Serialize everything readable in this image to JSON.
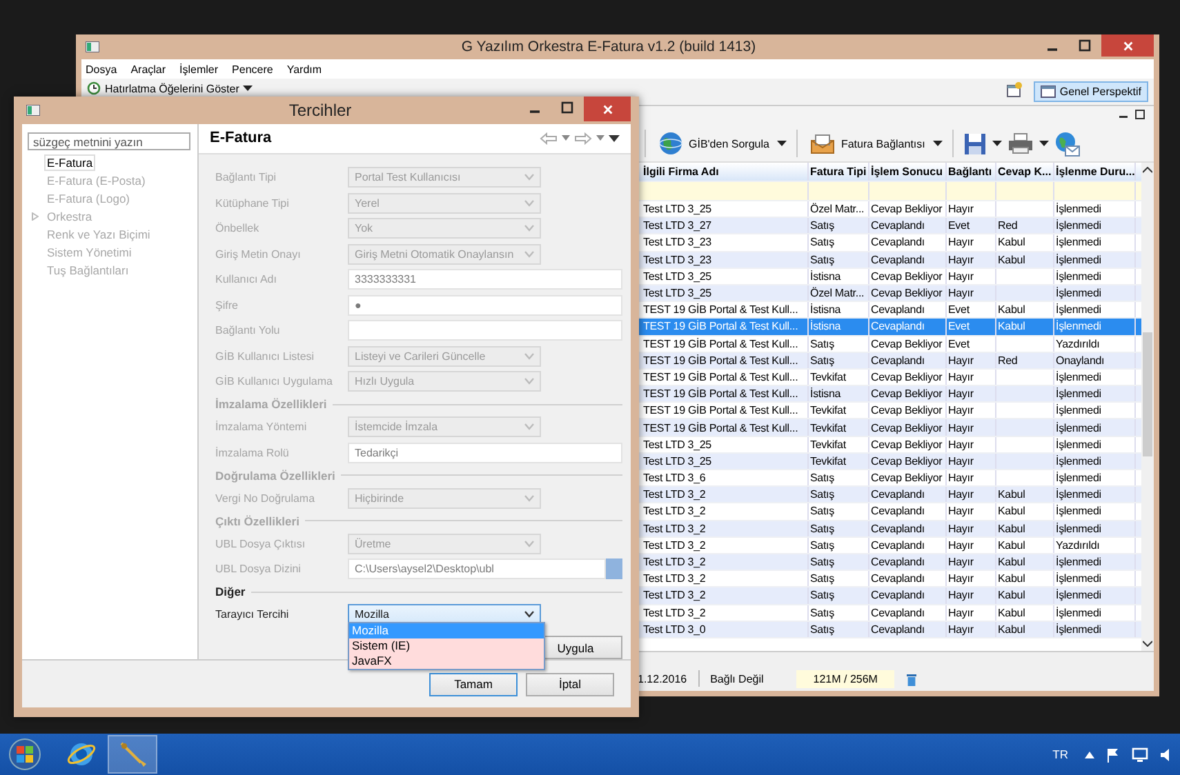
{
  "main_window": {
    "title": "G Yazılım Orkestra E-Fatura v1.2 (build 1413)",
    "menu": [
      "Dosya",
      "Araçlar",
      "İşlemler",
      "Pencere",
      "Yardım"
    ],
    "reminder_button": "Hatırlatma Öğelerini Göster",
    "perspective_button": {
      "label": "Genel Perspektif",
      "selected": true
    },
    "query_button": "GİB'den Sorgula",
    "link_button": "Fatura Bağlantısı",
    "table": {
      "columns": [
        "İlgili Firma Adı",
        "Fatura Tipi",
        "İşlem Sonucu",
        "Bağlantı",
        "Cevap K...",
        "İşlenme Duru..."
      ],
      "rows": [
        {
          "cells": [
            "Test LTD 3_25",
            "Özel Matr...",
            "Cevap Bekliyor",
            "Hayır",
            "",
            "İşlenmedi"
          ],
          "selected": false
        },
        {
          "cells": [
            "Test LTD 3_27",
            "Satış",
            "Cevaplandı",
            "Evet",
            "Red",
            "İşlenmedi"
          ],
          "selected": false
        },
        {
          "cells": [
            "Test LTD 3_23",
            "Satış",
            "Cevaplandı",
            "Hayır",
            "Kabul",
            "İşlenmedi"
          ],
          "selected": false
        },
        {
          "cells": [
            "Test LTD 3_23",
            "Satış",
            "Cevaplandı",
            "Hayır",
            "Kabul",
            "İşlenmedi"
          ],
          "selected": false
        },
        {
          "cells": [
            "Test LTD 3_25",
            "İstisna",
            "Cevap Bekliyor",
            "Hayır",
            "",
            "İşlenmedi"
          ],
          "selected": false
        },
        {
          "cells": [
            "Test LTD 3_25",
            "Özel Matr...",
            "Cevap Bekliyor",
            "Hayır",
            "",
            "İşlenmedi"
          ],
          "selected": false
        },
        {
          "cells": [
            "TEST 19 GİB Portal & Test Kull...",
            "İstisna",
            "Cevaplandı",
            "Evet",
            "Kabul",
            "İşlenmedi"
          ],
          "selected": false
        },
        {
          "cells": [
            "TEST 19 GİB Portal & Test Kull...",
            "İstisna",
            "Cevaplandı",
            "Evet",
            "Kabul",
            "İşlenmedi"
          ],
          "selected": true
        },
        {
          "cells": [
            "TEST 19 GİB Portal & Test Kull...",
            "Satış",
            "Cevap Bekliyor",
            "Evet",
            "",
            "Yazdırıldı"
          ],
          "selected": false
        },
        {
          "cells": [
            "TEST 19 GİB Portal & Test Kull...",
            "Satış",
            "Cevaplandı",
            "Hayır",
            "Red",
            "Onaylandı"
          ],
          "selected": false
        },
        {
          "cells": [
            "TEST 19 GİB Portal & Test Kull...",
            "Tevkifat",
            "Cevap Bekliyor",
            "Hayır",
            "",
            "İşlenmedi"
          ],
          "selected": false
        },
        {
          "cells": [
            "TEST 19 GİB Portal & Test Kull...",
            "İstisna",
            "Cevap Bekliyor",
            "Hayır",
            "",
            "İşlenmedi"
          ],
          "selected": false
        },
        {
          "cells": [
            "TEST 19 GİB Portal & Test Kull...",
            "Tevkifat",
            "Cevap Bekliyor",
            "Hayır",
            "",
            "İşlenmedi"
          ],
          "selected": false
        },
        {
          "cells": [
            "TEST 19 GİB Portal & Test Kull...",
            "Tevkifat",
            "Cevap Bekliyor",
            "Hayır",
            "",
            "İşlenmedi"
          ],
          "selected": false
        },
        {
          "cells": [
            "Test LTD 3_25",
            "Tevkifat",
            "Cevap Bekliyor",
            "Hayır",
            "",
            "İşlenmedi"
          ],
          "selected": false
        },
        {
          "cells": [
            "Test LTD 3_25",
            "Tevkifat",
            "Cevap Bekliyor",
            "Hayır",
            "",
            "İşlenmedi"
          ],
          "selected": false
        },
        {
          "cells": [
            "Test LTD 3_6",
            "Satış",
            "Cevap Bekliyor",
            "Hayır",
            "",
            "İşlenmedi"
          ],
          "selected": false
        },
        {
          "cells": [
            "Test LTD 3_2",
            "Satış",
            "Cevaplandı",
            "Hayır",
            "Kabul",
            "İşlenmedi"
          ],
          "selected": false
        },
        {
          "cells": [
            "Test LTD 3_2",
            "Satış",
            "Cevaplandı",
            "Hayır",
            "Kabul",
            "İşlenmedi"
          ],
          "selected": false
        },
        {
          "cells": [
            "Test LTD 3_2",
            "Satış",
            "Cevaplandı",
            "Hayır",
            "Kabul",
            "İşlenmedi"
          ],
          "selected": false
        },
        {
          "cells": [
            "Test LTD 3_2",
            "Satış",
            "Cevaplandı",
            "Hayır",
            "Kabul",
            "Yazdırıldı"
          ],
          "selected": false
        },
        {
          "cells": [
            "Test LTD 3_2",
            "Satış",
            "Cevaplandı",
            "Hayır",
            "Kabul",
            "İşlenmedi"
          ],
          "selected": false
        },
        {
          "cells": [
            "Test LTD 3_2",
            "Satış",
            "Cevaplandı",
            "Hayır",
            "Kabul",
            "İşlenmedi"
          ],
          "selected": false
        },
        {
          "cells": [
            "Test LTD 3_2",
            "Satış",
            "Cevaplandı",
            "Hayır",
            "Kabul",
            "İşlenmedi"
          ],
          "selected": false
        },
        {
          "cells": [
            "Test LTD 3_2",
            "Satış",
            "Cevaplandı",
            "Hayır",
            "Kabul",
            "İşlenmedi"
          ],
          "selected": false
        },
        {
          "cells": [
            "Test LTD 3_0",
            "Satış",
            "Cevaplandı",
            "Hayır",
            "Kabul",
            "İşlenmedi"
          ],
          "selected": false
        }
      ]
    },
    "status_bar": {
      "date": "1.12.2016",
      "connection": "Bağlı Değil",
      "memory": "121M / 256M"
    }
  },
  "dialog": {
    "title": "Tercihler",
    "filter": {
      "placeholder": "süzgeç metnini yazın"
    },
    "tree": [
      {
        "label": "E-Fatura",
        "selected": true,
        "disabled": false,
        "has_children": false
      },
      {
        "label": "E-Fatura (E-Posta)",
        "selected": false,
        "disabled": true,
        "has_children": false
      },
      {
        "label": "E-Fatura (Logo)",
        "selected": false,
        "disabled": true,
        "has_children": false
      },
      {
        "label": "Orkestra",
        "selected": false,
        "disabled": true,
        "has_children": true
      },
      {
        "label": "Renk ve Yazı Biçimi",
        "selected": false,
        "disabled": true,
        "has_children": false
      },
      {
        "label": "Sistem Yönetimi",
        "selected": false,
        "disabled": true,
        "has_children": false
      },
      {
        "label": "Tuş Bağlantıları",
        "selected": false,
        "disabled": true,
        "has_children": false
      }
    ],
    "page_title": "E-Fatura",
    "fields": [
      {
        "kind": "select",
        "label": "Bağlantı Tipi",
        "value": "Portal Test Kullanıcısı",
        "disabled": true
      },
      {
        "kind": "select",
        "label": "Kütüphane Tipi",
        "value": "Yerel",
        "disabled": true
      },
      {
        "kind": "select",
        "label": "Önbellek",
        "value": "Yok",
        "disabled": true
      },
      {
        "kind": "select",
        "label": "Giriş Metin Onayı",
        "value": "Giriş Metni Otomatik Onaylansın",
        "disabled": true
      },
      {
        "kind": "text",
        "label": "Kullanıcı Adı",
        "value": "3333333331",
        "disabled": true
      },
      {
        "kind": "text",
        "label": "Şifre",
        "value": "●",
        "disabled": true
      },
      {
        "kind": "text",
        "label": "Bağlantı Yolu",
        "disabled": true
      },
      {
        "kind": "select",
        "label": "GİB Kullanıcı Listesi",
        "value": "Listeyi ve Carileri Güncelle",
        "disabled": true
      },
      {
        "kind": "select",
        "label": "GİB Kullanıcı Uygulama",
        "value": "Hızlı Uygula",
        "disabled": true
      },
      {
        "kind": "section",
        "label": "İmzalama Özellikleri",
        "disabled": true
      },
      {
        "kind": "select",
        "label": "İmzalama Yöntemi",
        "value": "İstemcide İmzala",
        "disabled": true
      },
      {
        "kind": "text",
        "label": "İmzalama Rolü",
        "value": "Tedarikçi",
        "disabled": true
      },
      {
        "kind": "section",
        "label": "Doğrulama Özellikleri",
        "disabled": true
      },
      {
        "kind": "select",
        "label": "Vergi No Doğrulama",
        "value": "Hiçbirinde",
        "disabled": true
      },
      {
        "kind": "section",
        "label": "Çıktı Özellikleri",
        "disabled": true
      },
      {
        "kind": "select",
        "label": "UBL Dosya Çıktısı",
        "value": "Üretme",
        "disabled": true
      },
      {
        "kind": "path",
        "label": "UBL Dosya Dizini",
        "value": "C:\\Users\\aysel2\\Desktop\\ubl",
        "disabled": true
      },
      {
        "kind": "section",
        "label": "Diğer",
        "disabled": false
      },
      {
        "kind": "select",
        "label": "Tarayıcı Tercihi",
        "value": "Mozilla",
        "disabled": false
      }
    ],
    "dropdown_list": [
      {
        "label": "Mozilla",
        "selected": true
      },
      {
        "label": "Sistem (IE)",
        "selected": false
      },
      {
        "label": "JavaFX",
        "selected": false
      }
    ],
    "apply_button": "Uygula",
    "buttons": [
      {
        "label": "Tamam",
        "default": true
      },
      {
        "label": "İptal",
        "default": false
      }
    ]
  },
  "taskbar": {
    "language": "TR"
  }
}
